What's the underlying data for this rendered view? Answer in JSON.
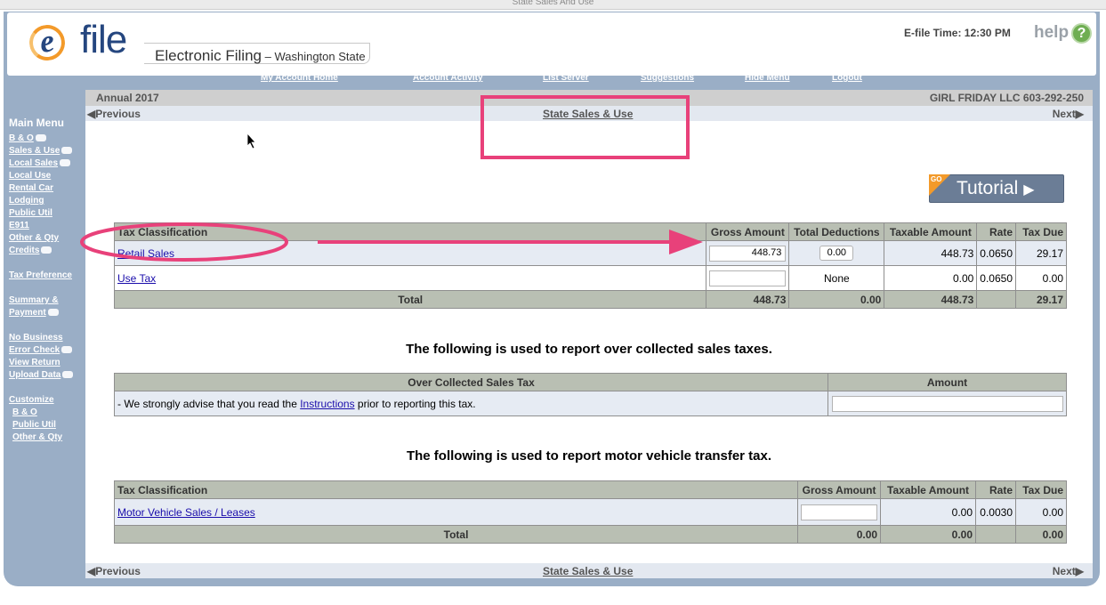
{
  "window": {
    "title": "State Sales And Use"
  },
  "header": {
    "logo_letter": "e",
    "logo_word": "file",
    "brand": "Electronic Filing",
    "brand_sub": " – Washington State",
    "efile_time": "E-file Time: 12:30 PM",
    "help_label": "help",
    "help_icon_glyph": "?"
  },
  "topnav": [
    {
      "label": "My Account Home"
    },
    {
      "label": "Account Activity"
    },
    {
      "label": "List Server"
    },
    {
      "label": "Suggestions"
    },
    {
      "label": "Hide Menu"
    },
    {
      "label": "Logout"
    }
  ],
  "sidebar": {
    "title": "Main Menu",
    "items": [
      {
        "label": "B & O",
        "icon": "video-icon"
      },
      {
        "label": "Sales & Use",
        "icon": "video-icon"
      },
      {
        "label": "Local Sales",
        "icon": "video-icon"
      },
      {
        "label": "Local Use"
      },
      {
        "label": "Rental Car"
      },
      {
        "label": "Lodging"
      },
      {
        "label": "Public Util"
      },
      {
        "label": "E911"
      },
      {
        "label": "Other & Qty"
      },
      {
        "label": "Credits",
        "icon": "video-icon"
      },
      {
        "label": "Tax Preference"
      },
      {
        "label": "Summary &"
      },
      {
        "label": "Payment",
        "icon": "video-icon"
      },
      {
        "label": "No Business"
      },
      {
        "label": "Error Check",
        "icon": "video-icon"
      },
      {
        "label": "View Return"
      },
      {
        "label": "Upload Data",
        "icon": "video-icon"
      },
      {
        "label": "Customize"
      },
      {
        "label": "B & O"
      },
      {
        "label": "Public Util"
      },
      {
        "label": "Other & Qty"
      }
    ]
  },
  "period": {
    "label": "Annual 2017",
    "account": "GIRL FRIDAY LLC 603-292-250"
  },
  "pager": {
    "previous": "◀Previous",
    "current": "State Sales & Use",
    "next": "Next▶"
  },
  "tutorial": {
    "label": "Tutorial",
    "badge": "GO",
    "icon": "video-camera-icon"
  },
  "sales_table": {
    "headers": [
      "Tax Classification",
      "Gross Amount",
      "Total Deductions",
      "Taxable Amount",
      "Rate",
      "Tax Due"
    ],
    "rows": [
      {
        "classification": "Retail Sales",
        "gross": "448.73",
        "deductions": "0.00",
        "taxable": "448.73",
        "rate": "0.0650",
        "tax_due": "29.17"
      },
      {
        "classification": "Use Tax",
        "gross": "",
        "deductions": "None",
        "taxable": "0.00",
        "rate": "0.0650",
        "tax_due": "0.00"
      }
    ],
    "total": {
      "label": "Total",
      "gross": "448.73",
      "deductions": "0.00",
      "taxable": "448.73",
      "tax_due": "29.17"
    }
  },
  "over_collected": {
    "heading": "The following is used to report over collected sales taxes.",
    "headers": [
      "Over Collected Sales Tax",
      "Amount"
    ],
    "advice_prefix": "- We strongly advise that you read the ",
    "advice_link": "Instructions",
    "advice_suffix": " prior to reporting this tax.",
    "amount": ""
  },
  "motor_vehicle": {
    "heading": "The following is used to report motor vehicle transfer tax.",
    "headers": [
      "Tax Classification",
      "Gross Amount",
      "Taxable Amount",
      "Rate",
      "Tax Due"
    ],
    "rows": [
      {
        "classification": "Motor Vehicle Sales / Leases",
        "gross": "",
        "taxable": "0.00",
        "rate": "0.0030",
        "tax_due": "0.00"
      }
    ],
    "total": {
      "label": "Total",
      "gross": "0.00",
      "taxable": "0.00",
      "tax_due": "0.00"
    }
  },
  "annotation_color": "#e8417a"
}
